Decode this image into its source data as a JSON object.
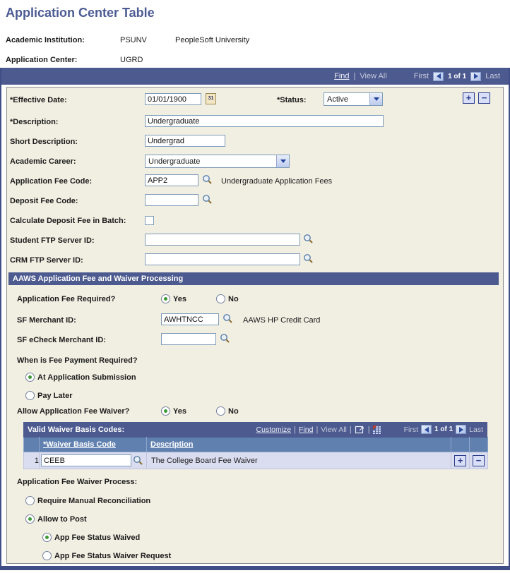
{
  "page": {
    "title": "Application Center Table"
  },
  "header_fields": {
    "institution_label": "Academic Institution:",
    "institution_code": "PSUNV",
    "institution_name": "PeopleSoft University",
    "center_label": "Application Center:",
    "center_code": "UGRD"
  },
  "scroll_nav": {
    "find": "Find",
    "separator": "|",
    "view_all": "View All",
    "first": "First",
    "position": "1 of 1",
    "last": "Last"
  },
  "main": {
    "effective_date": {
      "label": "*Effective Date:",
      "value": "01/01/1900"
    },
    "status": {
      "label": "*Status:",
      "value": "Active"
    },
    "description": {
      "label": "*Description:",
      "value": "Undergraduate"
    },
    "short_description": {
      "label": "Short Description:",
      "value": "Undergrad"
    },
    "academic_career": {
      "label": "Academic Career:",
      "value": "Undergraduate"
    },
    "application_fee_code": {
      "label": "Application Fee Code:",
      "value": "APP2",
      "description": "Undergraduate Application Fees"
    },
    "deposit_fee_code": {
      "label": "Deposit Fee Code:",
      "value": ""
    },
    "calculate_deposit": {
      "label": "Calculate Deposit Fee in Batch:",
      "checked": false
    },
    "student_ftp": {
      "label": "Student FTP Server ID:",
      "value": ""
    },
    "crm_ftp": {
      "label": "CRM FTP Server ID:",
      "value": ""
    }
  },
  "aaws": {
    "section_title": "AAWS Application Fee and Waiver Processing",
    "fee_required": {
      "label": "Application Fee Required?",
      "yes_label": "Yes",
      "no_label": "No",
      "selected": "Yes"
    },
    "sf_merchant_id": {
      "label": "SF Merchant ID:",
      "value": "AWHTNCC",
      "description": "AAWS HP Credit Card"
    },
    "sf_echeck_merchant_id": {
      "label": "SF eCheck Merchant ID:",
      "value": ""
    },
    "when_fee_payment": {
      "label": "When is Fee Payment Required?",
      "option_submission": "At Application Submission",
      "option_pay_later": "Pay Later",
      "selected": "At Application Submission"
    },
    "allow_fee_waiver": {
      "label": "Allow Application Fee Waiver?",
      "yes_label": "Yes",
      "no_label": "No",
      "selected": "Yes"
    }
  },
  "waiver_grid": {
    "title": "Valid Waiver Basis Codes:",
    "toolbar": {
      "customize": "Customize",
      "find": "Find",
      "view_all": "View All",
      "separator": "|",
      "first": "First",
      "position": "1 of 1",
      "last": "Last"
    },
    "columns": {
      "code": "*Waiver Basis Code",
      "description": "Description"
    },
    "rows": [
      {
        "number": "1",
        "code": "CEEB",
        "description": "The College Board Fee Waiver"
      }
    ]
  },
  "waiver_process": {
    "label": "Application Fee Waiver Process:",
    "option_manual": "Require Manual Reconciliation",
    "option_post": "Allow to Post",
    "option_waived": "App Fee Status Waived",
    "option_waiver_request": "App Fee Status Waiver Request",
    "selected": "Allow to Post",
    "selected_sub": "App Fee Status Waived"
  },
  "icons": {
    "add": "+",
    "remove": "−",
    "calendar_day": "31"
  },
  "colors": {
    "bar": "#4C5A8F",
    "grid_header": "#6080B0",
    "grid_row": "#DADCEF",
    "panel_bg": "#F1EEE2",
    "title": "#4C5B94",
    "radio_selected": "#3D9935"
  }
}
